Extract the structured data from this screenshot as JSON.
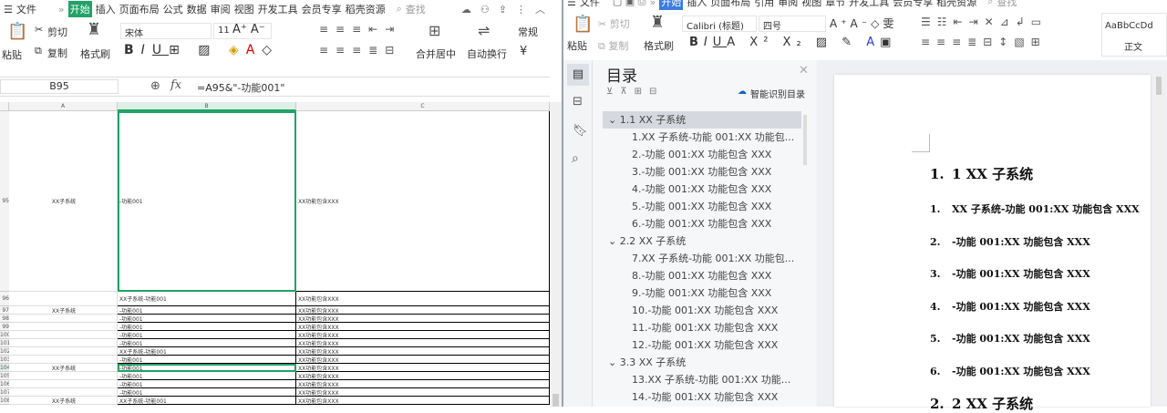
{
  "spreadsheet": {
    "menu": {
      "app_menu": "文件",
      "more": "»",
      "tabs": [
        "开始",
        "插入",
        "页面布局",
        "公式",
        "数据",
        "审阅",
        "视图",
        "开发工具",
        "会员专享",
        "稻壳资源"
      ],
      "search": "查找"
    },
    "ribbon": {
      "paste": "粘贴",
      "cut": "剪切",
      "copy": "复制",
      "format_painter": "格式刷",
      "font": "宋体",
      "size": "11",
      "merge": "合并居中",
      "wrap": "自动换行",
      "number_format": "常规",
      "currency": "¥"
    },
    "name_box": "B95",
    "fx": "fx",
    "formula": "=A95&\"-功能001\"",
    "columns": [
      "A",
      "B",
      "C"
    ],
    "rows": [
      {
        "num": "95",
        "a": "XX子系统",
        "b": "-功能001",
        "c": "XX功能包含XXX"
      },
      {
        "num": "96",
        "a": "",
        "b": "XX子系统-功能001",
        "c": "XX功能包含XXX"
      },
      {
        "num": "97",
        "a": "XX子系统",
        "b": "-功能001",
        "c": "XX功能包含XXX"
      },
      {
        "num": "98",
        "a": "",
        "b": "-功能001",
        "c": "XX功能包含XXX"
      },
      {
        "num": "99",
        "a": "",
        "b": "-功能001",
        "c": "XX功能包含XXX"
      },
      {
        "num": "100",
        "a": "",
        "b": "-功能001",
        "c": "XX功能包含XXX"
      },
      {
        "num": "101",
        "a": "",
        "b": "-功能001",
        "c": "XX功能包含XXX"
      },
      {
        "num": "102",
        "a": "",
        "b": "XX子系统-功能001",
        "c": "XX功能包含XXX"
      },
      {
        "num": "103",
        "a": "",
        "b": "-功能001",
        "c": "XX功能包含XXX"
      },
      {
        "num": "104",
        "a": "XX子系统",
        "b": "-功能001",
        "c": "XX功能包含XXX"
      },
      {
        "num": "105",
        "a": "",
        "b": "-功能001",
        "c": "XX功能包含XXX"
      },
      {
        "num": "106",
        "a": "",
        "b": "-功能001",
        "c": "XX功能包含XXX"
      },
      {
        "num": "107",
        "a": "",
        "b": "-功能001",
        "c": "XX功能包含XXX"
      },
      {
        "num": "108",
        "a": "XX子系统",
        "b": "XX子系统-功能001",
        "c": "XX功能包含XXX"
      }
    ]
  },
  "writer": {
    "menu": {
      "app_menu": "文件",
      "more": "»",
      "tabs": [
        "开始",
        "插入",
        "页面布局",
        "引用",
        "审阅",
        "视图",
        "章节",
        "开发工具",
        "会员专享",
        "稻壳资源"
      ],
      "search": "查找"
    },
    "ribbon": {
      "paste": "粘贴",
      "cut": "剪切",
      "copy": "复制",
      "format_painter": "格式刷",
      "font": "Calibri (标题)",
      "size": "四号",
      "style_preview": "AaBbCcDd",
      "style_name": "正文"
    },
    "toc": {
      "title": "目录",
      "smart": "智能识别目录",
      "items": [
        {
          "level": 1,
          "text": "1.1 XX 子系统",
          "selected": true
        },
        {
          "level": 2,
          "text": "1.XX 子系统-功能 001:XX 功能包..."
        },
        {
          "level": 2,
          "text": "2.-功能 001:XX 功能包含 XXX"
        },
        {
          "level": 2,
          "text": "3.-功能 001:XX 功能包含 XXX"
        },
        {
          "level": 2,
          "text": "4.-功能 001:XX 功能包含 XXX"
        },
        {
          "level": 2,
          "text": "5.-功能 001:XX 功能包含 XXX"
        },
        {
          "level": 2,
          "text": "6.-功能 001:XX 功能包含 XXX"
        },
        {
          "level": 1,
          "text": "2.2 XX 子系统"
        },
        {
          "level": 2,
          "text": "7.XX 子系统-功能 001:XX 功能包..."
        },
        {
          "level": 2,
          "text": "8.-功能 001:XX 功能包含 XXX"
        },
        {
          "level": 2,
          "text": "9.-功能 001:XX 功能包含 XXX"
        },
        {
          "level": 2,
          "text": "10.-功能 001:XX 功能包含 XXX"
        },
        {
          "level": 2,
          "text": "11.-功能 001:XX 功能包含 XXX"
        },
        {
          "level": 2,
          "text": "12.-功能 001:XX 功能包含 XXX"
        },
        {
          "level": 1,
          "text": "3.3 XX 子系统"
        },
        {
          "level": 2,
          "text": "13.XX 子系统-功能 001:XX 功能..."
        },
        {
          "level": 2,
          "text": "14.-功能 001:XX 功能包含 XXX"
        }
      ]
    },
    "document": {
      "heading1": {
        "num": "1.",
        "text": "1 XX 子系统"
      },
      "items": [
        {
          "num": "1.",
          "text": "XX 子系统-功能 001:XX 功能包含 XXX"
        },
        {
          "num": "2.",
          "text": "-功能 001:XX 功能包含 XXX"
        },
        {
          "num": "3.",
          "text": "-功能 001:XX 功能包含 XXX"
        },
        {
          "num": "4.",
          "text": "-功能 001:XX 功能包含 XXX"
        },
        {
          "num": "5.",
          "text": "-功能 001:XX 功能包含 XXX"
        },
        {
          "num": "6.",
          "text": "-功能 001:XX 功能包含 XXX"
        }
      ],
      "heading2": {
        "num": "2.",
        "text": "2 XX 子系统"
      }
    }
  }
}
